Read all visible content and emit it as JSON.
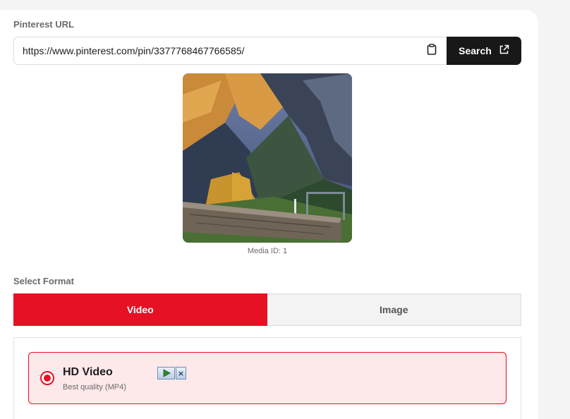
{
  "form": {
    "url_label": "Pinterest URL",
    "url_value": "https://www.pinterest.com/pin/3377768467766585/",
    "paste_icon": "clipboard-icon",
    "search_label": "Search",
    "search_icon": "external-link-icon"
  },
  "preview": {
    "media_id": "Media ID: 1"
  },
  "format": {
    "label": "Select Format",
    "tabs": [
      {
        "label": "Video",
        "active": true
      },
      {
        "label": "Image",
        "active": false
      }
    ]
  },
  "options": [
    {
      "title": "HD Video",
      "subtitle": "Best quality (MP4)",
      "selected": true
    }
  ],
  "colors": {
    "accent": "#e61124",
    "dark_button": "#181818",
    "selected_option_bg": "#fde8ea"
  }
}
